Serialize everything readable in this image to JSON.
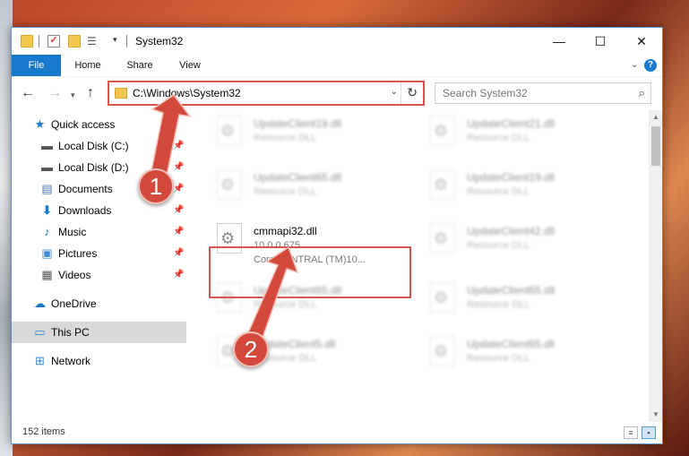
{
  "window": {
    "title": "System32",
    "controls": {
      "minimize": "—",
      "maximize": "☐",
      "close": "✕"
    }
  },
  "ribbon": {
    "tabs": [
      "File",
      "Home",
      "Share",
      "View"
    ],
    "help": "?"
  },
  "address": {
    "path": "C:\\Windows\\System32",
    "search_placeholder": "Search System32"
  },
  "sidebar": {
    "items": [
      {
        "label": "Quick access",
        "icon": "star-icon",
        "pinned": false
      },
      {
        "label": "Local Disk (C:)",
        "icon": "drive-icon",
        "pinned": true
      },
      {
        "label": "Local Disk (D:)",
        "icon": "drive-icon",
        "pinned": true
      },
      {
        "label": "Documents",
        "icon": "documents-icon",
        "pinned": true
      },
      {
        "label": "Downloads",
        "icon": "downloads-icon",
        "pinned": true
      },
      {
        "label": "Music",
        "icon": "music-icon",
        "pinned": true
      },
      {
        "label": "Pictures",
        "icon": "pictures-icon",
        "pinned": true
      },
      {
        "label": "Videos",
        "icon": "videos-icon",
        "pinned": true
      },
      {
        "label": "OneDrive",
        "icon": "onedrive-icon",
        "pinned": false
      },
      {
        "label": "This PC",
        "icon": "computer-icon",
        "pinned": false,
        "selected": true
      },
      {
        "label": "Network",
        "icon": "network-icon",
        "pinned": false
      }
    ]
  },
  "files": {
    "col1": [
      {
        "name": "UpdateClient19.dll",
        "type": "Resource DLL"
      },
      {
        "name": "UpdateClient65.dll",
        "type": "Resource DLL"
      },
      {
        "name": "cmmapi32.dll",
        "version": "10.0.0.675",
        "description": "CorelCENTRAL (TM)10...",
        "highlighted": true
      },
      {
        "name": "UpdateClient65.dll",
        "type": "Resource DLL"
      },
      {
        "name": "UpdateClient5.dll",
        "type": "Resource DLL"
      }
    ],
    "col2": [
      {
        "name": "UpdateClient21.dll",
        "type": "Resource DLL"
      },
      {
        "name": "UpdateClient19.dll",
        "type": "Resource DLL"
      },
      {
        "name": "UpdateClient42.dll",
        "type": "Resource DLL"
      },
      {
        "name": "UpdateClient65.dll",
        "type": "Resource DLL"
      },
      {
        "name": "UpdateClient65.dll",
        "type": "Resource DLL"
      }
    ]
  },
  "status": {
    "item_count": "152 items"
  },
  "annotations": {
    "step1": "1",
    "step2": "2"
  },
  "colors": {
    "accent": "#1979ca",
    "annotation_red": "#d34a3c"
  }
}
